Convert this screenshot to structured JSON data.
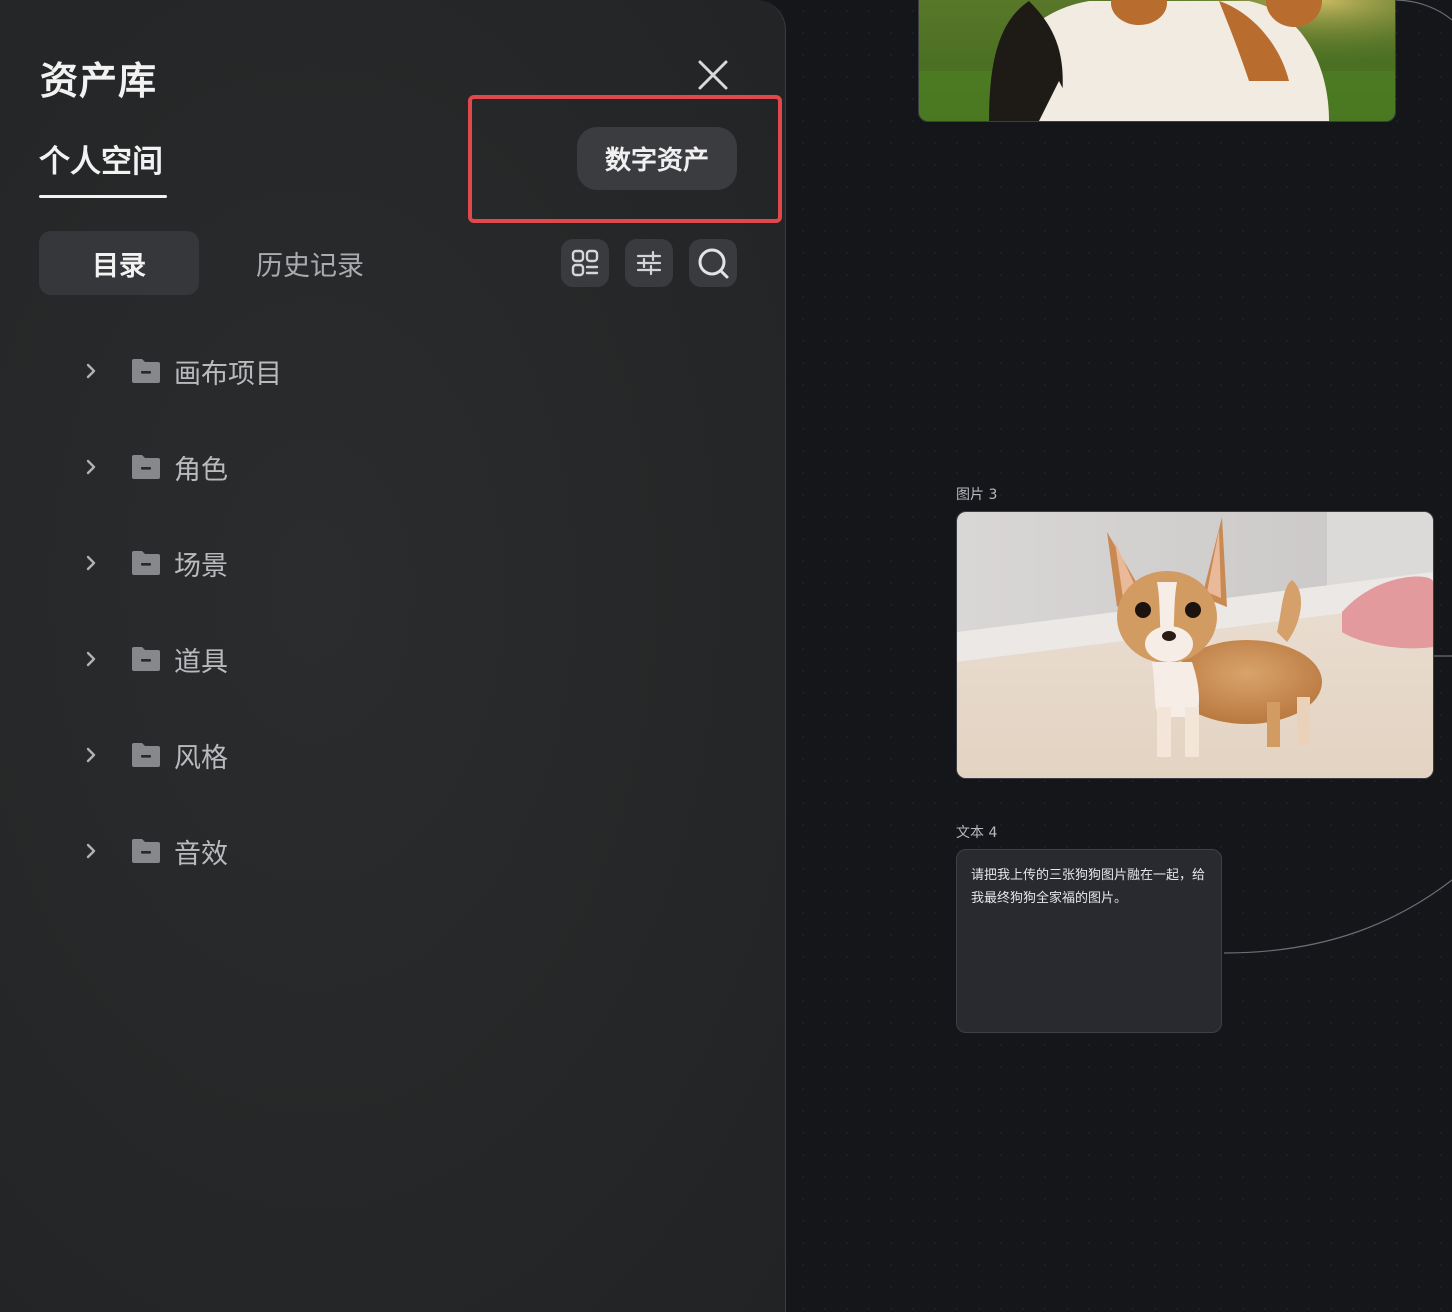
{
  "panel": {
    "title": "资产库",
    "tab_personal": "个人空间",
    "digital_assets_button": "数字资产",
    "segments": {
      "directory": "目录",
      "history": "历史记录"
    },
    "tree": [
      {
        "label": "画布项目"
      },
      {
        "label": "角色"
      },
      {
        "label": "场景"
      },
      {
        "label": "道具"
      },
      {
        "label": "风格"
      },
      {
        "label": "音效"
      }
    ]
  },
  "canvas": {
    "image_node_label": "图片 3",
    "text_node_label": "文本 4",
    "text_node_content": "请把我上传的三张狗狗图片融在一起，给我最终狗狗全家福的图片。"
  },
  "colors": {
    "highlight": "#e0484b",
    "panel_bg": "#262829",
    "canvas_bg": "#14161a"
  }
}
